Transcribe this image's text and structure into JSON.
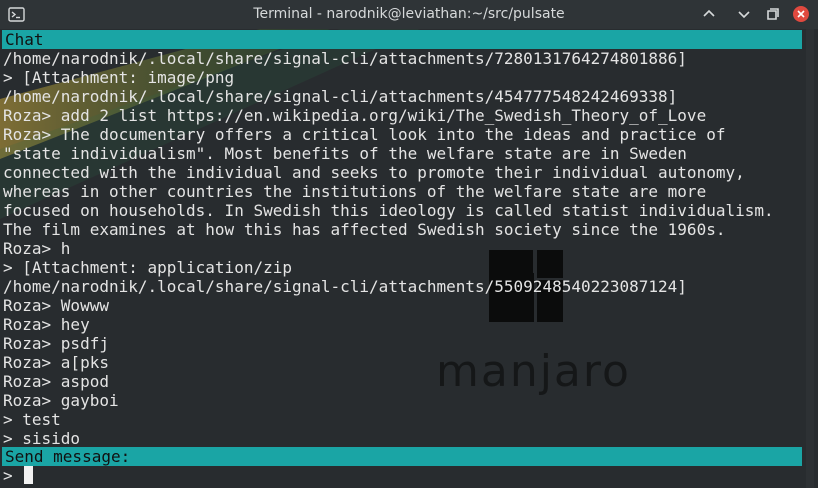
{
  "window": {
    "title": "Terminal - narodnik@leviathan:~/src/pulsate"
  },
  "chat": {
    "header": "Chat",
    "lines": [
      "/home/narodnik/.local/share/signal-cli/attachments/7280131764274801886]",
      "> [Attachment: image/png",
      "/home/narodnik/.local/share/signal-cli/attachments/454777548242469338]",
      "Roza> add 2 list https://en.wikipedia.org/wiki/The_Swedish_Theory_of_Love",
      "Roza> The documentary offers a critical look into the ideas and practice of",
      "\"state individualism\". Most benefits of the welfare state are in Sweden",
      "connected with the individual and seeks to promote their individual autonomy,",
      "whereas in other countries the institutions of the welfare state are more",
      "focused on households. In Swedish this ideology is called statist individualism.",
      "The film examines at how this has affected Swedish society since the 1960s.",
      "Roza> h",
      "> [Attachment: application/zip",
      "/home/narodnik/.local/share/signal-cli/attachments/5509248540223087124]",
      "Roza> Wowww",
      "Roza> hey",
      "Roza> psdfj",
      "Roza> a[pks",
      "Roza> aspod",
      "Roza> gayboi",
      "> test",
      "> sisido"
    ]
  },
  "input": {
    "label": "Send message:",
    "prompt": ">"
  },
  "wallpaper": {
    "logo_text": "manjaro"
  },
  "colors": {
    "accent_bar": "#1aa5a5",
    "close_button": "#e0493f"
  }
}
